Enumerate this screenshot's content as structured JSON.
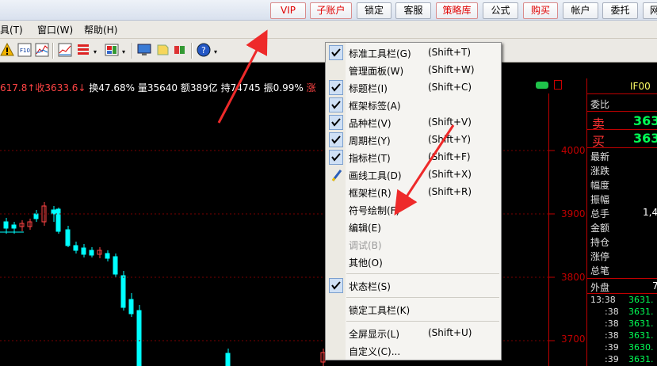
{
  "topbar": {
    "buttons": [
      {
        "label": "VIP",
        "style": "red"
      },
      {
        "label": "子账户",
        "style": "red"
      },
      {
        "label": "锁定",
        "style": "plain"
      },
      {
        "label": "客服",
        "style": "plain"
      },
      {
        "label": "策略库",
        "style": "red"
      },
      {
        "label": "公式",
        "style": "plain"
      },
      {
        "label": "购买",
        "style": "red"
      },
      {
        "label": "帐户",
        "style": "plain"
      },
      {
        "label": "委托",
        "style": "plain"
      },
      {
        "label": "网",
        "style": "plain"
      }
    ]
  },
  "menubar": {
    "items": [
      "具(T)",
      "窗口(W)",
      "帮助(H)"
    ]
  },
  "infoline": {
    "price": "617.8↑",
    "close": "收3633.6↓",
    "turnover": "换47.68%",
    "volume": "量35640",
    "amount": "额389亿",
    "hold": "持74745",
    "amplitude": "振0.99%",
    "tail": "涨"
  },
  "axis": {
    "ticks": [
      "4000",
      "3900",
      "3800",
      "3700"
    ]
  },
  "right_panel": {
    "code": "IF00",
    "weibi": "委比",
    "sell_label": "卖",
    "sell_value": "363",
    "buy_label": "买",
    "buy_value": "363",
    "fields": [
      "最新",
      "涨跌",
      "幅度",
      "振幅",
      "总手",
      "金额",
      "持仓",
      "涨停",
      "总笔",
      "外盘"
    ],
    "zongshou_value": "1,4",
    "waipan_value": "7",
    "ticks": [
      {
        "time": "13:38",
        "price": "3631."
      },
      {
        "time": ":38",
        "price": "3631."
      },
      {
        "time": ":38",
        "price": "3631."
      },
      {
        "time": ":38",
        "price": "3631."
      },
      {
        "time": ":39",
        "price": "3630."
      },
      {
        "time": ":39",
        "price": "3631."
      },
      {
        "time": ":39",
        "price": "3631."
      }
    ]
  },
  "context_menu": {
    "items": [
      {
        "label": "标准工具栏(G)",
        "shortcut": "(Shift+T)",
        "checked": true
      },
      {
        "label": "管理面板(W)",
        "shortcut": "(Shift+W)",
        "checked": false
      },
      {
        "label": "标题栏(I)",
        "shortcut": "(Shift+C)",
        "checked": true
      },
      {
        "label": "框架标签(A)",
        "shortcut": "",
        "checked": true
      },
      {
        "label": "品种栏(V)",
        "shortcut": "(Shift+V)",
        "checked": true
      },
      {
        "label": "周期栏(Y)",
        "shortcut": "(Shift+Y)",
        "checked": true
      },
      {
        "label": "指标栏(T)",
        "shortcut": "(Shift+F)",
        "checked": true
      },
      {
        "label": "画线工具(D)",
        "shortcut": "(Shift+X)",
        "checked": false,
        "icon": "pencil-icon"
      },
      {
        "label": "框架栏(R)",
        "shortcut": "(Shift+R)",
        "checked": false
      },
      {
        "label": "符号绘制(F)",
        "shortcut": "",
        "checked": false
      },
      {
        "label": "编辑(E)",
        "shortcut": "",
        "checked": false
      },
      {
        "label": "调试(B)",
        "shortcut": "",
        "checked": false,
        "disabled": true
      },
      {
        "label": "其他(O)",
        "shortcut": "",
        "checked": false
      },
      {
        "label": "状态栏(S)",
        "shortcut": "",
        "checked": true
      },
      {
        "label": "锁定工具栏(K)",
        "shortcut": "",
        "checked": false
      },
      {
        "label": "全屏显示(L)",
        "shortcut": "(Shift+U)",
        "checked": false
      },
      {
        "label": "自定义(C)...",
        "shortcut": "",
        "checked": false
      }
    ]
  },
  "colors": {
    "up": "#ff4444",
    "down": "#00ffff",
    "accent_red": "#e00000",
    "green": "#00ff55"
  }
}
